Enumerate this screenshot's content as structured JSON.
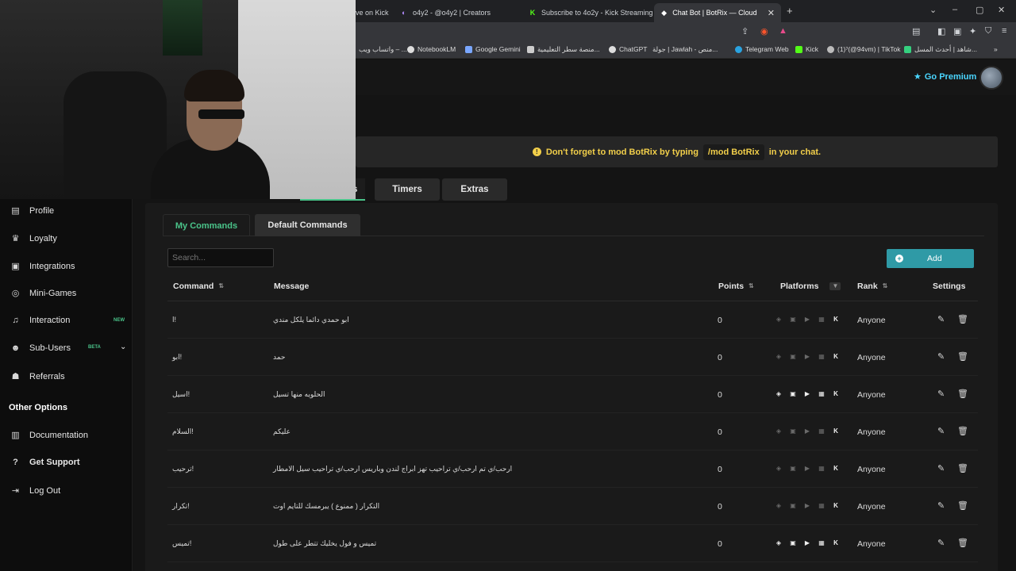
{
  "browser": {
    "tabs": [
      {
        "label": "ve on Kick",
        "icon": "generic"
      },
      {
        "label": "o4y2 - @o4y2 | Creators",
        "icon": "creators"
      },
      {
        "label": "Subscribe to 4o2y - Kick Streaming",
        "icon": "kick"
      },
      {
        "label": "Chat Bot | BotRix — Cloud Strea",
        "icon": "botrix"
      }
    ],
    "bookmarks": [
      "واتساب ويب – ...",
      "NotebookLM",
      "Google Gemini",
      "منصة سطر التعليمية...",
      "ChatGPT",
      "جولة | Jawlah - منص...",
      "Telegram Web",
      "Kick",
      "(1)ˀ(@94vm) | TikTok",
      "شاهد | أحدث المسل..."
    ]
  },
  "header": {
    "premium_label": "Go Premium"
  },
  "notice": {
    "pre": "Don't forget to mod BotRix by typing",
    "code": "/mod BotRix",
    "post": "in your chat."
  },
  "top_tabs": {
    "commands_suffix": "s",
    "timers": "Timers",
    "extras": "Extras"
  },
  "sidebar": {
    "items": [
      {
        "label": "Profile",
        "icon": "id-card-icon"
      },
      {
        "label": "Loyalty",
        "icon": "trophy-icon"
      },
      {
        "label": "Integrations",
        "icon": "puzzle-icon"
      },
      {
        "label": "Mini-Games",
        "icon": "gamepad-icon"
      },
      {
        "label": "Interaction",
        "icon": "music-icon",
        "badge": "NEW"
      },
      {
        "label": "Sub-Users",
        "icon": "users-icon",
        "badge": "BETA"
      },
      {
        "label": "Referrals",
        "icon": "referral-icon"
      }
    ],
    "other_title": "Other Options",
    "other_items": [
      {
        "label": "Documentation",
        "icon": "book-icon"
      },
      {
        "label": "Get Support",
        "icon": "help-icon"
      },
      {
        "label": "Log Out",
        "icon": "logout-icon"
      }
    ]
  },
  "commands": {
    "subtabs": {
      "mine": "My Commands",
      "default": "Default Commands"
    },
    "search_placeholder": "Search...",
    "add_label": "Add",
    "columns": {
      "command": "Command",
      "message": "Message",
      "points": "Points",
      "platforms": "Platforms",
      "rank": "Rank",
      "settings": "Settings"
    },
    "rows": [
      {
        "command": "!ا",
        "message": "ابو حمدي دائما يلكل مندي",
        "points": "0",
        "rank": "Anyone",
        "platforms": [
          false,
          false,
          false,
          false,
          true
        ]
      },
      {
        "command": "!ابو",
        "message": "حمد",
        "points": "0",
        "rank": "Anyone",
        "platforms": [
          false,
          false,
          false,
          false,
          true
        ]
      },
      {
        "command": "!اسيل",
        "message": "الحلويه منها تسيل",
        "points": "0",
        "rank": "Anyone",
        "platforms": [
          true,
          true,
          true,
          true,
          true
        ]
      },
      {
        "command": "!السلام",
        "message": "عليكم",
        "points": "0",
        "rank": "Anyone",
        "platforms": [
          false,
          false,
          false,
          false,
          true
        ]
      },
      {
        "command": "!ترحيب",
        "message": "ارحب/ي تم ارحب/ي تراحيب تهز ابراج لندن وباريس ارحب/ي تراحيب سيل الامطار",
        "points": "0",
        "rank": "Anyone",
        "platforms": [
          false,
          false,
          false,
          false,
          true
        ]
      },
      {
        "command": "!تكرار",
        "message": "التكرار ( ممنوع ) يبرمسك للتايم اوت",
        "points": "0",
        "rank": "Anyone",
        "platforms": [
          false,
          false,
          false,
          false,
          true
        ]
      },
      {
        "command": "!تميس",
        "message": "تميس و فول يخليك تتطر على طول",
        "points": "0",
        "rank": "Anyone",
        "platforms": [
          true,
          true,
          true,
          true,
          true
        ]
      }
    ]
  },
  "colors": {
    "accent_green": "#4ac48a",
    "add_button": "#2f9aa6",
    "notice_text": "#f2cf4a",
    "premium": "#4ad6ff"
  }
}
